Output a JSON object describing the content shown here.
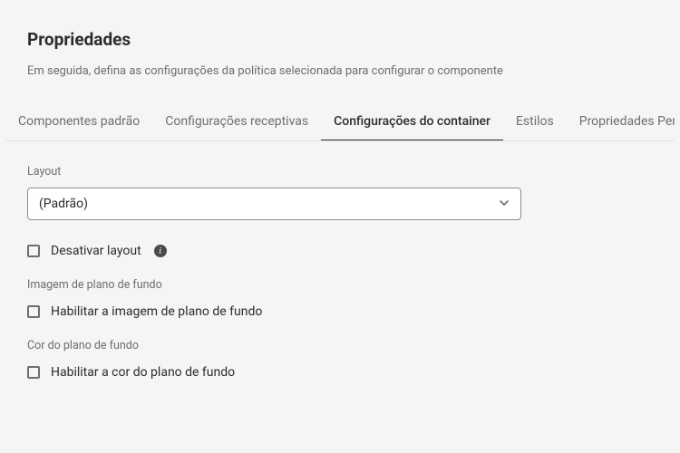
{
  "header": {
    "title": "Propriedades",
    "subtitle": "Em seguida, defina as configurações da política selecionada para configurar o componente"
  },
  "tabs": [
    {
      "label": "Componentes padrão"
    },
    {
      "label": "Configurações receptivas"
    },
    {
      "label": "Configurações do container"
    },
    {
      "label": "Estilos"
    },
    {
      "label": "Propriedades Personal"
    }
  ],
  "layout": {
    "label": "Layout",
    "selected": "(Padrão)",
    "disable_label": "Desativar layout"
  },
  "bg_image": {
    "heading": "Imagem de plano de fundo",
    "enable_label": "Habilitar a imagem de plano de fundo"
  },
  "bg_color": {
    "heading": "Cor do plano de fundo",
    "enable_label": "Habilitar a cor do plano de fundo"
  },
  "icons": {
    "info": "i"
  }
}
